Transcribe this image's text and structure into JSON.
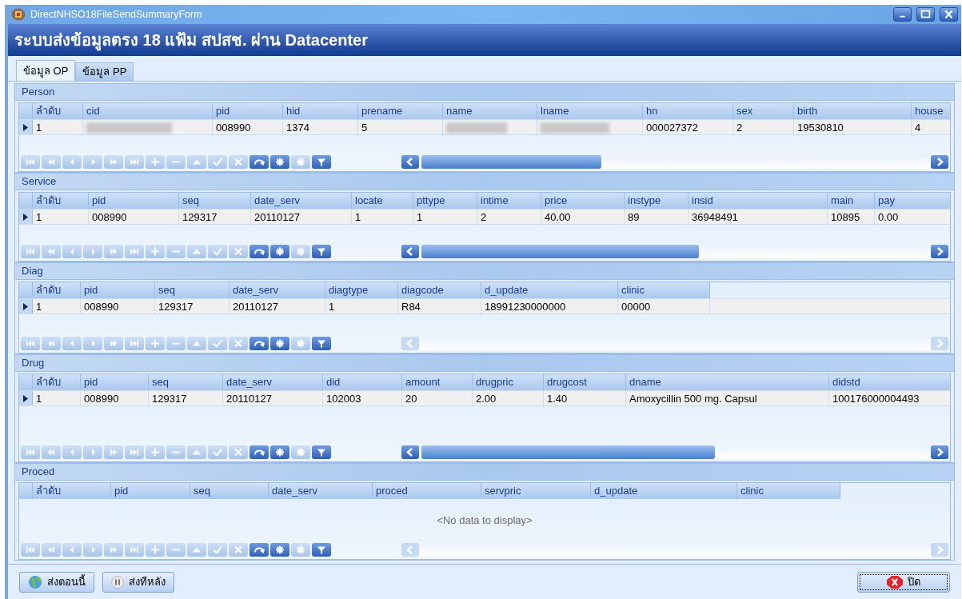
{
  "window": {
    "title": "DirectNHSO18FileSendSummaryForm"
  },
  "header": "ระบบส่งข้อมูลตรง 18 แฟ้ม สปสช. ผ่าน Datacenter",
  "tabs": [
    {
      "label": "ข้อมูล OP",
      "selected": true
    },
    {
      "label": "ข้อมูล PP",
      "selected": false
    }
  ],
  "navigator_buttons": [
    {
      "kind": "first",
      "disabled": true
    },
    {
      "kind": "prev_page",
      "disabled": true
    },
    {
      "kind": "prev",
      "disabled": true
    },
    {
      "kind": "next",
      "disabled": true
    },
    {
      "kind": "next_page",
      "disabled": true
    },
    {
      "kind": "last",
      "disabled": true
    },
    {
      "kind": "insert",
      "disabled": true
    },
    {
      "kind": "delete",
      "disabled": true
    },
    {
      "kind": "edit",
      "disabled": true
    },
    {
      "kind": "post",
      "disabled": true
    },
    {
      "kind": "cancel",
      "disabled": true
    },
    {
      "kind": "refresh",
      "disabled": false
    },
    {
      "kind": "bookmark",
      "disabled": false
    },
    {
      "kind": "goto_bookmark",
      "disabled": true
    },
    {
      "kind": "filter",
      "disabled": false
    }
  ],
  "panels": [
    {
      "title": "Person",
      "columns": [
        "ลำดับ",
        "cid",
        "pid",
        "hid",
        "prename",
        "name",
        "lname",
        "hn",
        "sex",
        "birth",
        "house"
      ],
      "rows": [
        {
          "current": true,
          "cells": [
            "1",
            {
              "kind": "blurred"
            },
            "008990",
            "1374",
            "5",
            {
              "kind": "blurred"
            },
            {
              "kind": "blurred"
            },
            "000027372",
            "2",
            "19530810",
            "4"
          ]
        }
      ],
      "scroll_disabled": false
    },
    {
      "title": "Service",
      "columns": [
        "ลำดับ",
        "pid",
        "seq",
        "date_serv",
        "locate",
        "pttype",
        "intime",
        "price",
        "instype",
        "insid",
        "main",
        "pay"
      ],
      "rows": [
        {
          "current": true,
          "cells": [
            "1",
            "008990",
            "129317",
            "20110127",
            "1",
            "1",
            "2",
            "40.00",
            "89",
            "36948491",
            "10895",
            "0.00"
          ]
        }
      ],
      "scroll_disabled": false
    },
    {
      "title": "Diag",
      "columns": [
        "ลำดับ",
        "pid",
        "seq",
        "date_serv",
        "diagtype",
        "diagcode",
        "d_update",
        "clinic"
      ],
      "rows": [
        {
          "current": true,
          "cells": [
            "1",
            "008990",
            "129317",
            "20110127",
            "1",
            "R84",
            "18991230000000",
            "00000"
          ]
        }
      ],
      "scroll_disabled": true
    },
    {
      "title": "Drug",
      "columns": [
        "ลำดับ",
        "pid",
        "seq",
        "date_serv",
        "did",
        "amount",
        "drugpric",
        "drugcost",
        "dname",
        "didstd"
      ],
      "rows": [
        {
          "current": true,
          "cells": [
            "1",
            "008990",
            "129317",
            "20110127",
            "102003",
            "20",
            "2.00",
            "1.40",
            "Amoxycillin 500 mg. Capsul",
            "100176000004493"
          ]
        }
      ],
      "scroll_disabled": false
    },
    {
      "title": "Proced",
      "columns": [
        "ลำดับ",
        "pid",
        "seq",
        "date_serv",
        "proced",
        "servpric",
        "d_update",
        "clinic"
      ],
      "empty_message": "<No data to display>",
      "scroll_disabled": true
    }
  ],
  "buttons": [
    {
      "kind": "send_now",
      "label": "ส่งตอนนี้",
      "focused": false
    },
    {
      "kind": "send_later",
      "label": "ส่งทีหลัง",
      "focused": false
    },
    {
      "kind": "close",
      "label": "ปิด",
      "focused": true
    }
  ]
}
